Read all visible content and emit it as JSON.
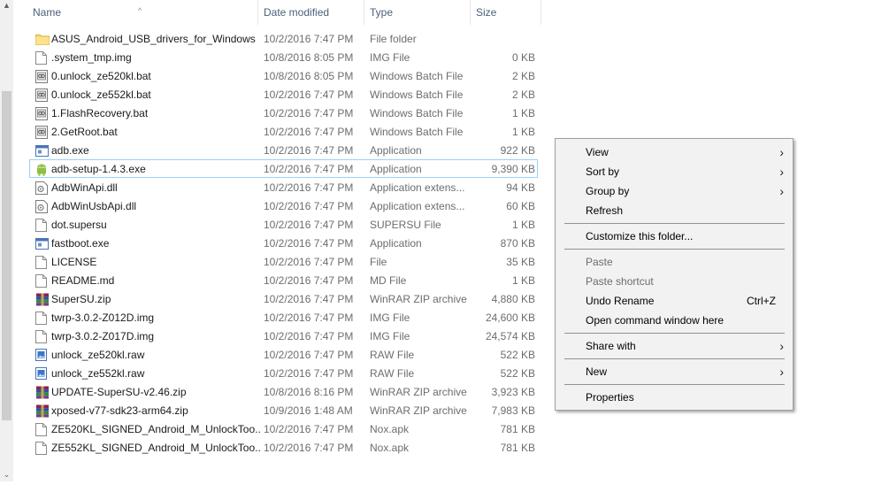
{
  "columns": {
    "name": "Name",
    "date": "Date modified",
    "type": "Type",
    "size": "Size"
  },
  "files": [
    {
      "name": "ASUS_Android_USB_drivers_for_Windows",
      "date": "10/2/2016 7:47 PM",
      "type": "File folder",
      "size": "",
      "icon": "folder-icon"
    },
    {
      "name": ".system_tmp.img",
      "date": "10/8/2016 8:05 PM",
      "type": "IMG File",
      "size": "0 KB",
      "icon": "file-icon"
    },
    {
      "name": "0.unlock_ze520kl.bat",
      "date": "10/8/2016 8:05 PM",
      "type": "Windows Batch File",
      "size": "2 KB",
      "icon": "batch-file-icon"
    },
    {
      "name": "0.unlock_ze552kl.bat",
      "date": "10/2/2016 7:47 PM",
      "type": "Windows Batch File",
      "size": "2 KB",
      "icon": "batch-file-icon"
    },
    {
      "name": "1.FlashRecovery.bat",
      "date": "10/2/2016 7:47 PM",
      "type": "Windows Batch File",
      "size": "1 KB",
      "icon": "batch-file-icon"
    },
    {
      "name": "2.GetRoot.bat",
      "date": "10/2/2016 7:47 PM",
      "type": "Windows Batch File",
      "size": "1 KB",
      "icon": "batch-file-icon"
    },
    {
      "name": "adb.exe",
      "date": "10/2/2016 7:47 PM",
      "type": "Application",
      "size": "922 KB",
      "icon": "application-icon"
    },
    {
      "name": "adb-setup-1.4.3.exe",
      "date": "10/2/2016 7:47 PM",
      "type": "Application",
      "size": "9,390 KB",
      "icon": "android-icon"
    },
    {
      "name": "AdbWinApi.dll",
      "date": "10/2/2016 7:47 PM",
      "type": "Application extens...",
      "size": "94 KB",
      "icon": "dll-icon"
    },
    {
      "name": "AdbWinUsbApi.dll",
      "date": "10/2/2016 7:47 PM",
      "type": "Application extens...",
      "size": "60 KB",
      "icon": "dll-icon"
    },
    {
      "name": "dot.supersu",
      "date": "10/2/2016 7:47 PM",
      "type": "SUPERSU File",
      "size": "1 KB",
      "icon": "file-icon"
    },
    {
      "name": "fastboot.exe",
      "date": "10/2/2016 7:47 PM",
      "type": "Application",
      "size": "870 KB",
      "icon": "application-icon"
    },
    {
      "name": "LICENSE",
      "date": "10/2/2016 7:47 PM",
      "type": "File",
      "size": "35 KB",
      "icon": "file-icon"
    },
    {
      "name": "README.md",
      "date": "10/2/2016 7:47 PM",
      "type": "MD File",
      "size": "1 KB",
      "icon": "file-icon"
    },
    {
      "name": "SuperSU.zip",
      "date": "10/2/2016 7:47 PM",
      "type": "WinRAR ZIP archive",
      "size": "4,880 KB",
      "icon": "winrar-icon"
    },
    {
      "name": "twrp-3.0.2-Z012D.img",
      "date": "10/2/2016 7:47 PM",
      "type": "IMG File",
      "size": "24,600 KB",
      "icon": "file-icon"
    },
    {
      "name": "twrp-3.0.2-Z017D.img",
      "date": "10/2/2016 7:47 PM",
      "type": "IMG File",
      "size": "24,574 KB",
      "icon": "file-icon"
    },
    {
      "name": "unlock_ze520kl.raw",
      "date": "10/2/2016 7:47 PM",
      "type": "RAW File",
      "size": "522 KB",
      "icon": "raw-image-icon"
    },
    {
      "name": "unlock_ze552kl.raw",
      "date": "10/2/2016 7:47 PM",
      "type": "RAW File",
      "size": "522 KB",
      "icon": "raw-image-icon"
    },
    {
      "name": "UPDATE-SuperSU-v2.46.zip",
      "date": "10/8/2016 8:16 PM",
      "type": "WinRAR ZIP archive",
      "size": "3,923 KB",
      "icon": "winrar-icon"
    },
    {
      "name": "xposed-v77-sdk23-arm64.zip",
      "date": "10/9/2016 1:48 AM",
      "type": "WinRAR ZIP archive",
      "size": "7,983 KB",
      "icon": "winrar-icon"
    },
    {
      "name": "ZE520KL_SIGNED_Android_M_UnlockToo...",
      "date": "10/2/2016 7:47 PM",
      "type": "Nox.apk",
      "size": "781 KB",
      "icon": "file-icon"
    },
    {
      "name": "ZE552KL_SIGNED_Android_M_UnlockToo...",
      "date": "10/2/2016 7:47 PM",
      "type": "Nox.apk",
      "size": "781 KB",
      "icon": "file-icon"
    }
  ],
  "selected_index": 7,
  "context_menu": {
    "view": "View",
    "sort_by": "Sort by",
    "group_by": "Group by",
    "refresh": "Refresh",
    "customize": "Customize this folder...",
    "paste": "Paste",
    "paste_shortcut": "Paste shortcut",
    "undo_rename": "Undo Rename",
    "undo_shortcut": "Ctrl+Z",
    "open_cmd": "Open command window here",
    "share_with": "Share with",
    "new": "New",
    "properties": "Properties"
  },
  "colors": {
    "selection_border": "#99d1ff",
    "header_text": "#4c607a",
    "folder": "#f8d775"
  }
}
